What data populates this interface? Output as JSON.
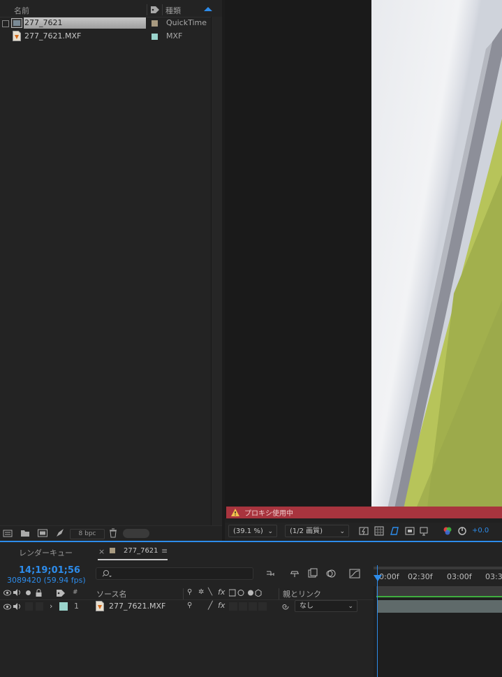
{
  "project": {
    "columns": {
      "name": "名前",
      "type": "種類"
    },
    "items": [
      {
        "name": "277_7621",
        "type": "QuickTime",
        "swatch": "#a89a80"
      },
      {
        "name": "277_7621.MXF",
        "type": "MXF",
        "swatch": "#9ad4cc"
      }
    ],
    "footer": {
      "bpc": "8 bpc"
    }
  },
  "viewer": {
    "warning": "プロキシ使用中",
    "zoom": "(39.1 %)",
    "resolution": "(1/2 画質)",
    "exposure": "+0.0"
  },
  "timeline": {
    "tabs": {
      "render_queue": "レンダーキュー",
      "comp": "277_7621",
      "close": "×",
      "menu": "≡"
    },
    "timecode": "14;19;01;56",
    "frames": "3089420 (59.94 fps)",
    "columns": {
      "num": "#",
      "source": "ソース名",
      "parent": "親とリンク",
      "fx": "fx"
    },
    "layers": [
      {
        "num": "1",
        "name": "277_7621.MXF",
        "parent": "なし",
        "label_color": "#9ad4cc"
      }
    ],
    "ruler_ticks": [
      "0:00f",
      "02:30f",
      "03:00f",
      "03:3"
    ]
  },
  "colors": {
    "accent": "#2d8ceb",
    "warning": "#a8343e"
  }
}
